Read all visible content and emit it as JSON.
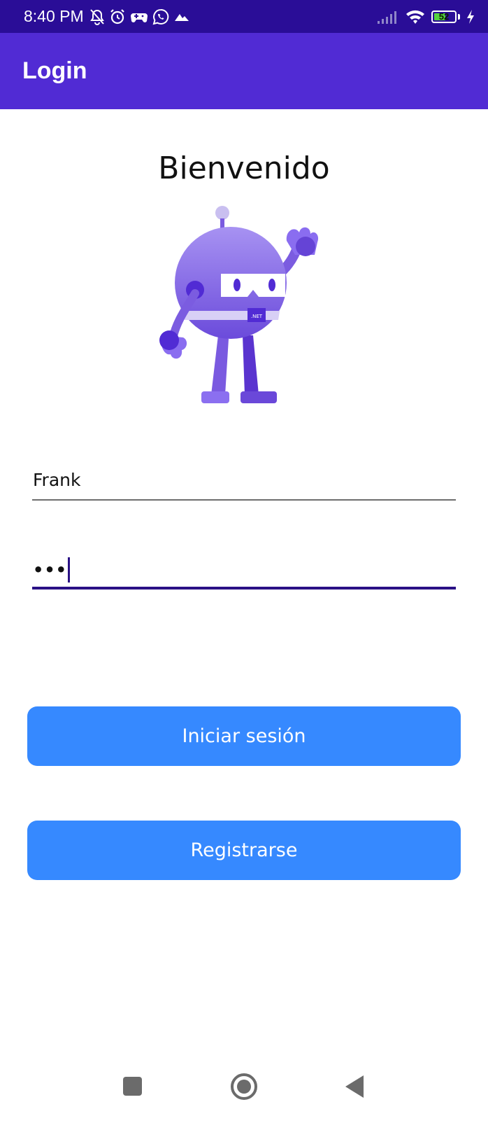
{
  "status_bar": {
    "time": "8:40 PM",
    "battery_level": "52",
    "icons": [
      "bell-off-icon",
      "alarm-icon",
      "gamepad-icon",
      "whatsapp-icon",
      "mountain-icon",
      "signal-icon",
      "wifi-icon",
      "battery-icon",
      "charging-icon"
    ]
  },
  "app_bar": {
    "title": "Login"
  },
  "main": {
    "welcome": "Bienvenido",
    "mascot_badge": ".NET",
    "username_value": "Frank",
    "password_masked": "•••",
    "login_button": "Iniciar sesión",
    "register_button": "Registrarse"
  },
  "nav_bar": {
    "icons": [
      "recents-icon",
      "home-icon",
      "back-icon"
    ]
  },
  "colors": {
    "status_bar": "#2a0d97",
    "app_bar": "#512bd4",
    "button": "#3689ff",
    "focused_underline": "#2a1185"
  }
}
